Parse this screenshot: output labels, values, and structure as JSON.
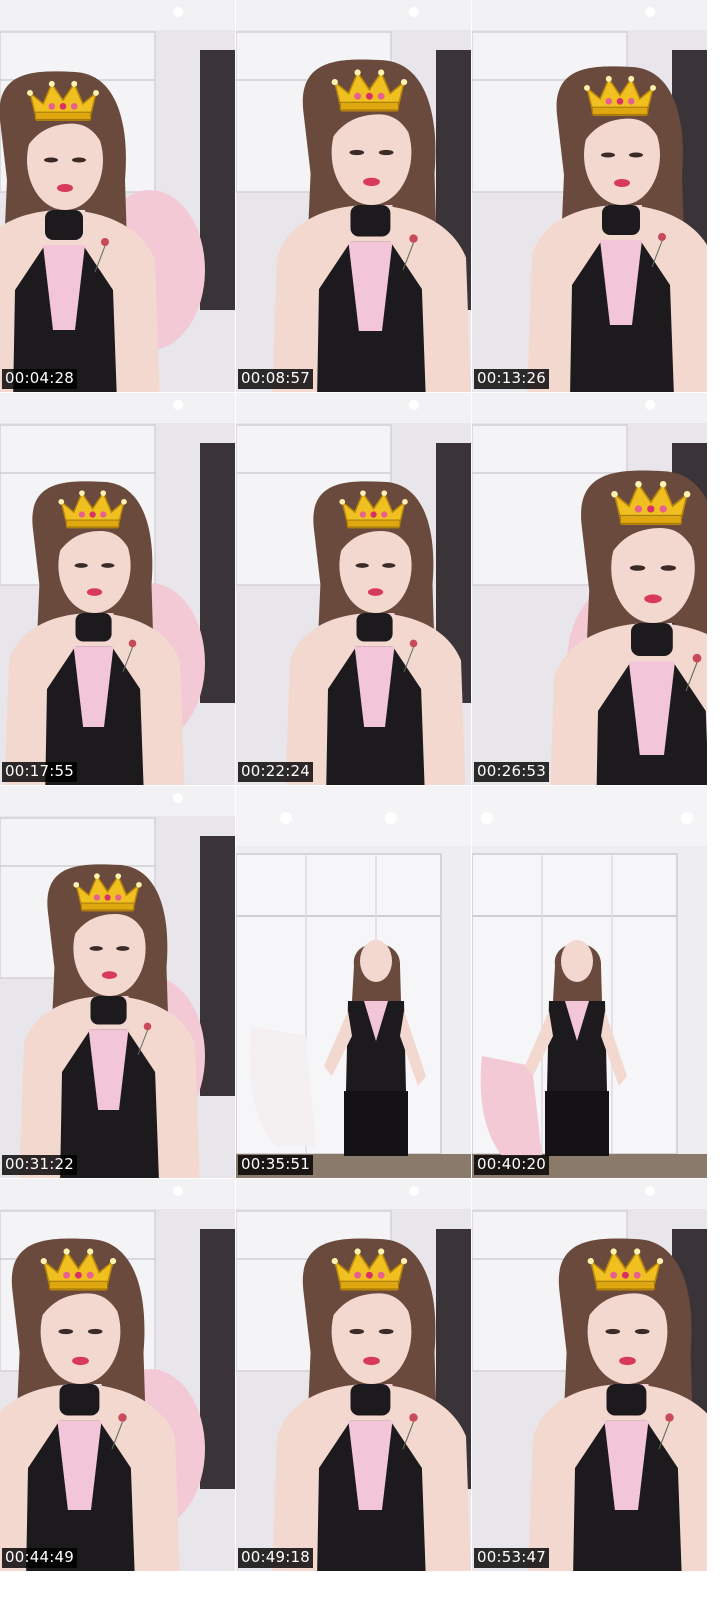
{
  "frames": [
    {
      "timestamp": "00:04:28",
      "scene": "close",
      "crown": true
    },
    {
      "timestamp": "00:08:57",
      "scene": "close",
      "crown": true
    },
    {
      "timestamp": "00:13:26",
      "scene": "close",
      "crown": true
    },
    {
      "timestamp": "00:17:55",
      "scene": "close",
      "crown": true
    },
    {
      "timestamp": "00:22:24",
      "scene": "close",
      "crown": true
    },
    {
      "timestamp": "00:26:53",
      "scene": "close",
      "crown": true
    },
    {
      "timestamp": "00:31:22",
      "scene": "close",
      "crown": true
    },
    {
      "timestamp": "00:35:51",
      "scene": "wide",
      "crown": false
    },
    {
      "timestamp": "00:40:20",
      "scene": "wide",
      "crown": false
    },
    {
      "timestamp": "00:44:49",
      "scene": "close",
      "crown": true
    },
    {
      "timestamp": "00:49:18",
      "scene": "close",
      "crown": true
    },
    {
      "timestamp": "00:53:47",
      "scene": "close",
      "crown": true
    }
  ],
  "colors": {
    "wall": "#e8e6ea",
    "cabinet": "#f4f4f6",
    "door": "#3a3438",
    "hair": "#6b4a3e",
    "skin": "#f3d8cf",
    "top_black": "#1c1a1c",
    "top_pink": "#f2c6d8",
    "chair_pink": "#f3c9d6",
    "crown_gold": "#f0c020",
    "timestamp_bg": "#000000",
    "timestamp_text": "#ffffff"
  }
}
